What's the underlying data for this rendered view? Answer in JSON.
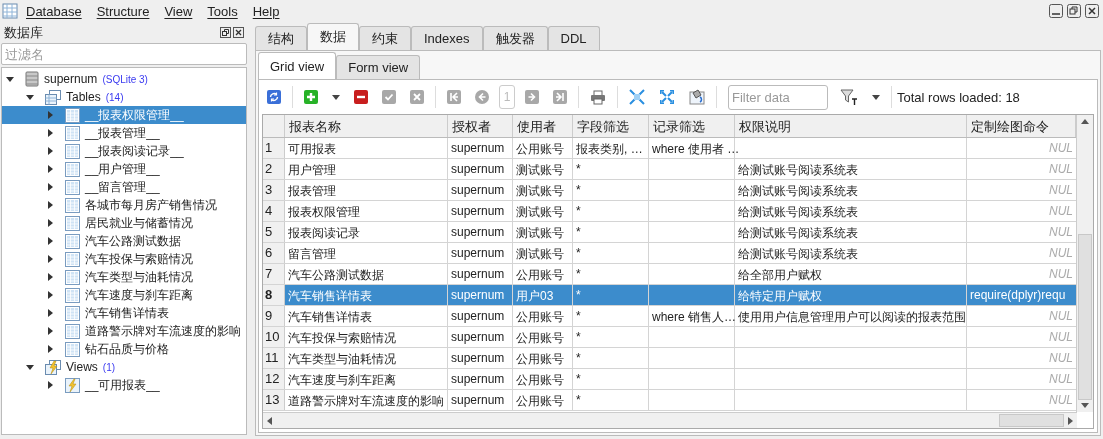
{
  "menu": [
    {
      "label": "Database"
    },
    {
      "label": "Structure"
    },
    {
      "label": "View"
    },
    {
      "label": "Tools"
    },
    {
      "label": "Help"
    }
  ],
  "sidebar": {
    "title": "数据库",
    "filter": {
      "placeholder": "过滤名"
    },
    "tree": [
      {
        "label": "supernum",
        "tag": "(SQLite 3)",
        "kind": "database",
        "expanded": true,
        "selected": false,
        "children": [
          {
            "label": "Tables",
            "tag": "(14)",
            "kind": "tables",
            "expanded": true,
            "selected": false,
            "children": [
              {
                "label": "__报表权限管理__",
                "kind": "table",
                "expanded": false,
                "selected": true
              },
              {
                "label": "__报表管理__",
                "kind": "table",
                "expanded": false,
                "selected": false
              },
              {
                "label": "__报表阅读记录__",
                "kind": "table",
                "expanded": false,
                "selected": false
              },
              {
                "label": "__用户管理__",
                "kind": "table",
                "expanded": false,
                "selected": false
              },
              {
                "label": "__留言管理__",
                "kind": "table",
                "expanded": false,
                "selected": false
              },
              {
                "label": "各城市每月房产销售情况",
                "kind": "table",
                "expanded": false,
                "selected": false
              },
              {
                "label": "居民就业与储蓄情况",
                "kind": "table",
                "expanded": false,
                "selected": false
              },
              {
                "label": "汽车公路测试数据",
                "kind": "table",
                "expanded": false,
                "selected": false
              },
              {
                "label": "汽车投保与索赔情况",
                "kind": "table",
                "expanded": false,
                "selected": false
              },
              {
                "label": "汽车类型与油耗情况",
                "kind": "table",
                "expanded": false,
                "selected": false
              },
              {
                "label": "汽车速度与刹车距离",
                "kind": "table",
                "expanded": false,
                "selected": false
              },
              {
                "label": "汽车销售详情表",
                "kind": "table",
                "expanded": false,
                "selected": false
              },
              {
                "label": "道路警示牌对车流速度的影响",
                "kind": "table",
                "expanded": false,
                "selected": false
              },
              {
                "label": "钻石品质与价格",
                "kind": "table",
                "expanded": false,
                "selected": false
              }
            ]
          },
          {
            "label": "Views",
            "tag": "(1)",
            "kind": "views",
            "expanded": true,
            "selected": false,
            "children": [
              {
                "label": "__可用报表__",
                "kind": "view",
                "expanded": false,
                "selected": false
              }
            ]
          }
        ]
      }
    ]
  },
  "tabs": [
    {
      "label": "结构",
      "selected": false
    },
    {
      "label": "数据",
      "selected": true
    },
    {
      "label": "约束",
      "selected": false
    },
    {
      "label": "Indexes",
      "selected": false
    },
    {
      "label": "触发器",
      "selected": false
    },
    {
      "label": "DDL",
      "selected": false
    }
  ],
  "subtabs": [
    {
      "label": "Grid view",
      "selected": true
    },
    {
      "label": "Form view",
      "selected": false
    }
  ],
  "toolbar": {
    "page": "1",
    "filter": {
      "placeholder": "Filter data"
    },
    "status": "Total rows loaded: 18"
  },
  "table": {
    "columns": [
      "报表名称",
      "授权者",
      "使用者",
      "字段筛选",
      "记录筛选",
      "权限说明",
      "定制绘图命令"
    ],
    "rows": [
      {
        "number": "1",
        "selected": false,
        "cells": [
          "可用报表",
          "supernum",
          "公用账号",
          "报表类别, …",
          "where 使用者 …",
          null,
          "NUL"
        ],
        "last_is_null": true
      },
      {
        "number": "2",
        "selected": false,
        "cells": [
          "用户管理",
          "supernum",
          "测试账号",
          "*",
          null,
          "给测试账号阅读系统表",
          "NUL"
        ],
        "last_is_null": true
      },
      {
        "number": "3",
        "selected": false,
        "cells": [
          "报表管理",
          "supernum",
          "测试账号",
          "*",
          null,
          "给测试账号阅读系统表",
          "NUL"
        ],
        "last_is_null": true
      },
      {
        "number": "4",
        "selected": false,
        "cells": [
          "报表权限管理",
          "supernum",
          "测试账号",
          "*",
          null,
          "给测试账号阅读系统表",
          "NUL"
        ],
        "last_is_null": true
      },
      {
        "number": "5",
        "selected": false,
        "cells": [
          "报表阅读记录",
          "supernum",
          "测试账号",
          "*",
          null,
          "给测试账号阅读系统表",
          "NUL"
        ],
        "last_is_null": true
      },
      {
        "number": "6",
        "selected": false,
        "cells": [
          "留言管理",
          "supernum",
          "测试账号",
          "*",
          null,
          "给测试账号阅读系统表",
          "NUL"
        ],
        "last_is_null": true
      },
      {
        "number": "7",
        "selected": false,
        "cells": [
          "汽车公路测试数据",
          "supernum",
          "公用账号",
          "*",
          null,
          "给全部用户赋权",
          "NUL"
        ],
        "last_is_null": true
      },
      {
        "number": "8",
        "selected": true,
        "cells": [
          "汽车销售详情表",
          "supernum",
          "用户03",
          "*",
          null,
          "给特定用户赋权",
          "require(dplyr)requ"
        ],
        "last_is_null": false
      },
      {
        "number": "9",
        "selected": false,
        "cells": [
          "汽车销售详情表",
          "supernum",
          "公用账号",
          "*",
          "where  销售人…",
          "使用用户信息管理用户可以阅读的报表范围",
          "NUL"
        ],
        "last_is_null": true
      },
      {
        "number": "10",
        "selected": false,
        "cells": [
          "汽车投保与索赔情况",
          "supernum",
          "公用账号",
          "*",
          null,
          null,
          "NUL"
        ],
        "last_is_null": true
      },
      {
        "number": "11",
        "selected": false,
        "cells": [
          "汽车类型与油耗情况",
          "supernum",
          "公用账号",
          "*",
          null,
          null,
          "NUL"
        ],
        "last_is_null": true
      },
      {
        "number": "12",
        "selected": false,
        "cells": [
          "汽车速度与刹车距离",
          "supernum",
          "公用账号",
          "*",
          null,
          null,
          "NUL"
        ],
        "last_is_null": true
      },
      {
        "number": "13",
        "selected": false,
        "cells": [
          "道路警示牌对车流速度的影响",
          "supernum",
          "公用账号",
          "*",
          null,
          null,
          "NUL"
        ],
        "last_is_null": true
      }
    ]
  }
}
